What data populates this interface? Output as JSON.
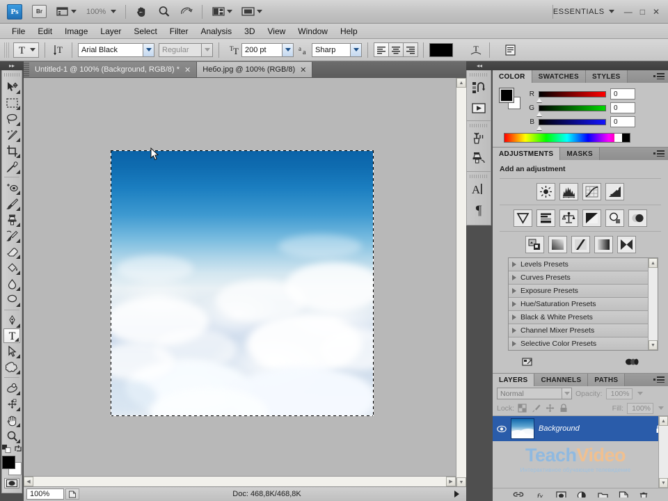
{
  "app": {
    "logo": "Ps",
    "bridge_label": "Br",
    "zoom_level": "100%",
    "workspace": "ESSENTIALS",
    "window_buttons": [
      "minimize",
      "maximize",
      "close"
    ]
  },
  "menubar": {
    "items": [
      "File",
      "Edit",
      "Image",
      "Layer",
      "Select",
      "Filter",
      "Analysis",
      "3D",
      "View",
      "Window",
      "Help"
    ]
  },
  "options_bar": {
    "tool": "type-tool",
    "orientation_label": "toggle-text-orientation",
    "font_family": "Arial Black",
    "font_style": "Regular",
    "font_size": "200 pt",
    "anti_alias_label": "aa",
    "anti_alias": "Sharp",
    "align": [
      "align-left",
      "align-center",
      "align-right"
    ],
    "align_active": "align-left",
    "text_color": "#000000",
    "warp_label": "create-warped-text",
    "panels_label": "toggle-character-paragraph-panels"
  },
  "toolbox": {
    "tools": [
      {
        "name": "move-tool",
        "glyph": "move"
      },
      {
        "name": "rectangular-marquee-tool",
        "glyph": "marquee"
      },
      {
        "name": "lasso-tool",
        "glyph": "lasso"
      },
      {
        "name": "quick-selection-tool",
        "glyph": "wand"
      },
      {
        "name": "crop-tool",
        "glyph": "crop"
      },
      {
        "name": "eyedropper-tool",
        "glyph": "eyedropper"
      },
      {
        "name": "spot-healing-brush-tool",
        "glyph": "healing"
      },
      {
        "name": "brush-tool",
        "glyph": "brush"
      },
      {
        "name": "clone-stamp-tool",
        "glyph": "stamp"
      },
      {
        "name": "history-brush-tool",
        "glyph": "history-brush"
      },
      {
        "name": "eraser-tool",
        "glyph": "eraser"
      },
      {
        "name": "gradient-tool",
        "glyph": "gradient"
      },
      {
        "name": "blur-tool",
        "glyph": "blur"
      },
      {
        "name": "dodge-tool",
        "glyph": "dodge"
      },
      {
        "name": "pen-tool",
        "glyph": "pen"
      },
      {
        "name": "horizontal-type-tool",
        "glyph": "T",
        "selected": true
      },
      {
        "name": "path-selection-tool",
        "glyph": "path-arrow"
      },
      {
        "name": "custom-shape-tool",
        "glyph": "shape"
      },
      {
        "name": "3d-rotate-tool",
        "glyph": "rotate3d"
      },
      {
        "name": "3d-orbit-tool",
        "glyph": "orbit3d"
      },
      {
        "name": "hand-tool",
        "glyph": "hand"
      },
      {
        "name": "zoom-tool",
        "glyph": "magnifier"
      }
    ],
    "foreground_color": "#000000",
    "background_color": "#ffffff",
    "quick_mask_label": "edit-in-quick-mask-mode"
  },
  "documents": {
    "tabs": [
      {
        "title": "Untitled-1 @ 100% (Background, RGB/8) *",
        "active": true,
        "closable": true
      },
      {
        "title": "Небо.jpg @ 100% (RGB/8)",
        "active": false,
        "closable": true
      }
    ]
  },
  "canvas": {
    "selection": "select-all-marching-ants",
    "image_description": "sky-with-clouds"
  },
  "status_bar": {
    "zoom": "100%",
    "doc_info": "Doc: 468,8K/468,8K"
  },
  "icon_dock": {
    "icons": [
      {
        "name": "history-panel-icon",
        "glyph": "history"
      },
      {
        "name": "actions-panel-icon",
        "glyph": "play"
      },
      {
        "name": "tool-presets-panel-icon",
        "glyph": "tool-presets"
      },
      {
        "name": "clone-source-panel-icon",
        "glyph": "clone-source"
      },
      {
        "name": "character-panel-icon",
        "glyph": "A"
      },
      {
        "name": "paragraph-panel-icon",
        "glyph": "¶"
      }
    ]
  },
  "color_panel": {
    "tabs": [
      "COLOR",
      "SWATCHES",
      "STYLES"
    ],
    "active_tab": "COLOR",
    "foreground": "#000000",
    "background": "#ffffff",
    "channels": [
      {
        "label": "R",
        "value": "0"
      },
      {
        "label": "G",
        "value": "0"
      },
      {
        "label": "B",
        "value": "0"
      }
    ]
  },
  "adjustments_panel": {
    "tabs": [
      "ADJUSTMENTS",
      "MASKS"
    ],
    "active_tab": "ADJUSTMENTS",
    "title": "Add an adjustment",
    "row1": [
      "brightness-contrast-icon",
      "levels-icon",
      "curves-icon",
      "exposure-icon"
    ],
    "row2": [
      "vibrance-icon",
      "hue-saturation-icon",
      "color-balance-icon",
      "black-white-icon",
      "photo-filter-icon",
      "channel-mixer-icon"
    ],
    "row3": [
      "invert-icon",
      "posterize-icon",
      "threshold-icon",
      "gradient-map-icon",
      "selective-color-icon"
    ],
    "presets": [
      "Levels Presets",
      "Curves Presets",
      "Exposure Presets",
      "Hue/Saturation Presets",
      "Black & White Presets",
      "Channel Mixer Presets",
      "Selective Color Presets"
    ],
    "footer": [
      "return-to-adjustment-list-icon",
      "view-previous-state-icon"
    ]
  },
  "layers_panel": {
    "tabs": [
      "LAYERS",
      "CHANNELS",
      "PATHS"
    ],
    "active_tab": "LAYERS",
    "blend_mode": "Normal",
    "opacity_label": "Opacity:",
    "opacity_value": "100%",
    "lock_label": "Lock:",
    "lock_icons": [
      "lock-transparent-pixels",
      "lock-image-pixels",
      "lock-position",
      "lock-all"
    ],
    "fill_label": "Fill:",
    "fill_value": "100%",
    "layers": [
      {
        "name": "Background",
        "visible": true,
        "locked": true,
        "selected": true
      }
    ],
    "footer_icons": [
      "link-layers-icon",
      "add-layer-style-icon",
      "add-layer-mask-icon",
      "new-fill-adjustment-layer-icon",
      "new-group-icon",
      "new-layer-icon",
      "delete-layer-icon"
    ]
  },
  "watermark": {
    "part1": "Teach",
    "part2": "Video",
    "subtitle": "Интерактивное обучающее телевидение"
  }
}
